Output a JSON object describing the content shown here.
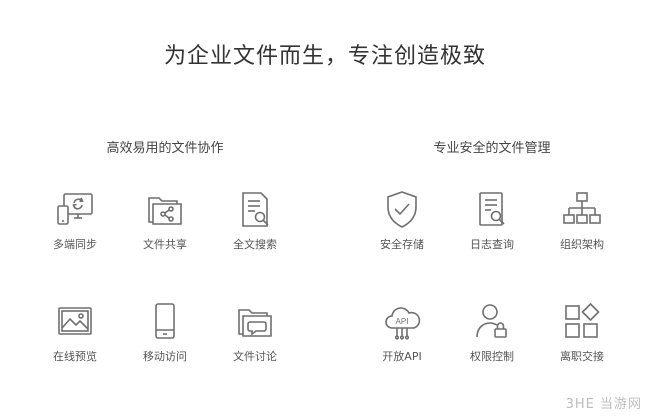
{
  "headline": "为企业文件而生，专注创造极致",
  "left_section": {
    "title": "高效易用的文件协作",
    "features": [
      {
        "label": "多端同步",
        "icon": "multi-device-sync-icon"
      },
      {
        "label": "文件共享",
        "icon": "folder-share-icon"
      },
      {
        "label": "全文搜索",
        "icon": "document-search-icon"
      },
      {
        "label": "在线预览",
        "icon": "image-preview-icon"
      },
      {
        "label": "移动访问",
        "icon": "mobile-phone-icon"
      },
      {
        "label": "文件讨论",
        "icon": "folder-chat-icon"
      }
    ]
  },
  "right_section": {
    "title": "专业安全的文件管理",
    "features": [
      {
        "label": "安全存储",
        "icon": "shield-check-icon"
      },
      {
        "label": "日志查询",
        "icon": "log-search-icon"
      },
      {
        "label": "组织架构",
        "icon": "org-chart-icon"
      },
      {
        "label": "开放API",
        "icon": "api-cloud-icon",
        "badge": "API"
      },
      {
        "label": "权限控制",
        "icon": "user-lock-icon"
      },
      {
        "label": "离职交接",
        "icon": "handover-grid-icon"
      }
    ]
  },
  "watermark": "3HE 当游网",
  "colors": {
    "icon_stroke": "#6f6f6f",
    "text": "#333333",
    "label": "#555555"
  }
}
